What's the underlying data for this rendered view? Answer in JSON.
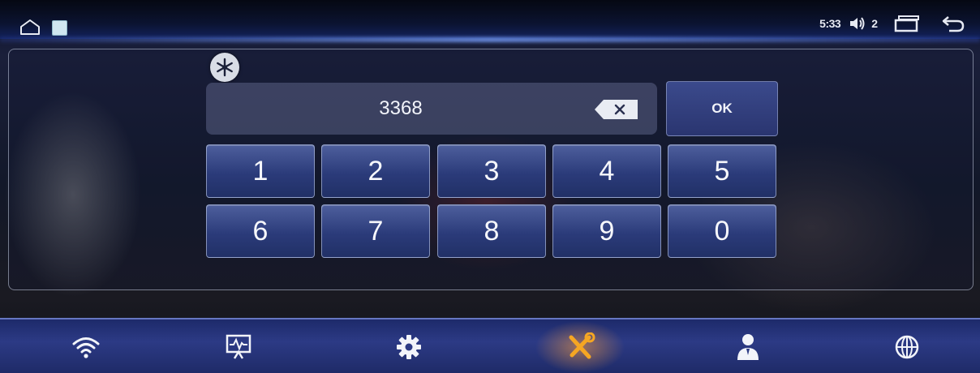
{
  "status_bar": {
    "time": "5:33",
    "volume_level": "2",
    "icons": [
      "home-icon",
      "app-icon",
      "volume-icon",
      "recent-apps-icon",
      "back-icon"
    ]
  },
  "pin_entry": {
    "value": "3368",
    "backspace_icon": "backspace-icon",
    "ok_label": "OK",
    "badge_icon": "snowflake-icon"
  },
  "keypad": {
    "keys": [
      "1",
      "2",
      "3",
      "4",
      "5",
      "6",
      "7",
      "8",
      "9",
      "0"
    ]
  },
  "dock": {
    "items": [
      "wifi-icon",
      "display-icon",
      "gear-icon",
      "tools-icon",
      "user-icon",
      "globe-icon"
    ],
    "active": "tools-icon",
    "active_color": "#f5a623"
  }
}
